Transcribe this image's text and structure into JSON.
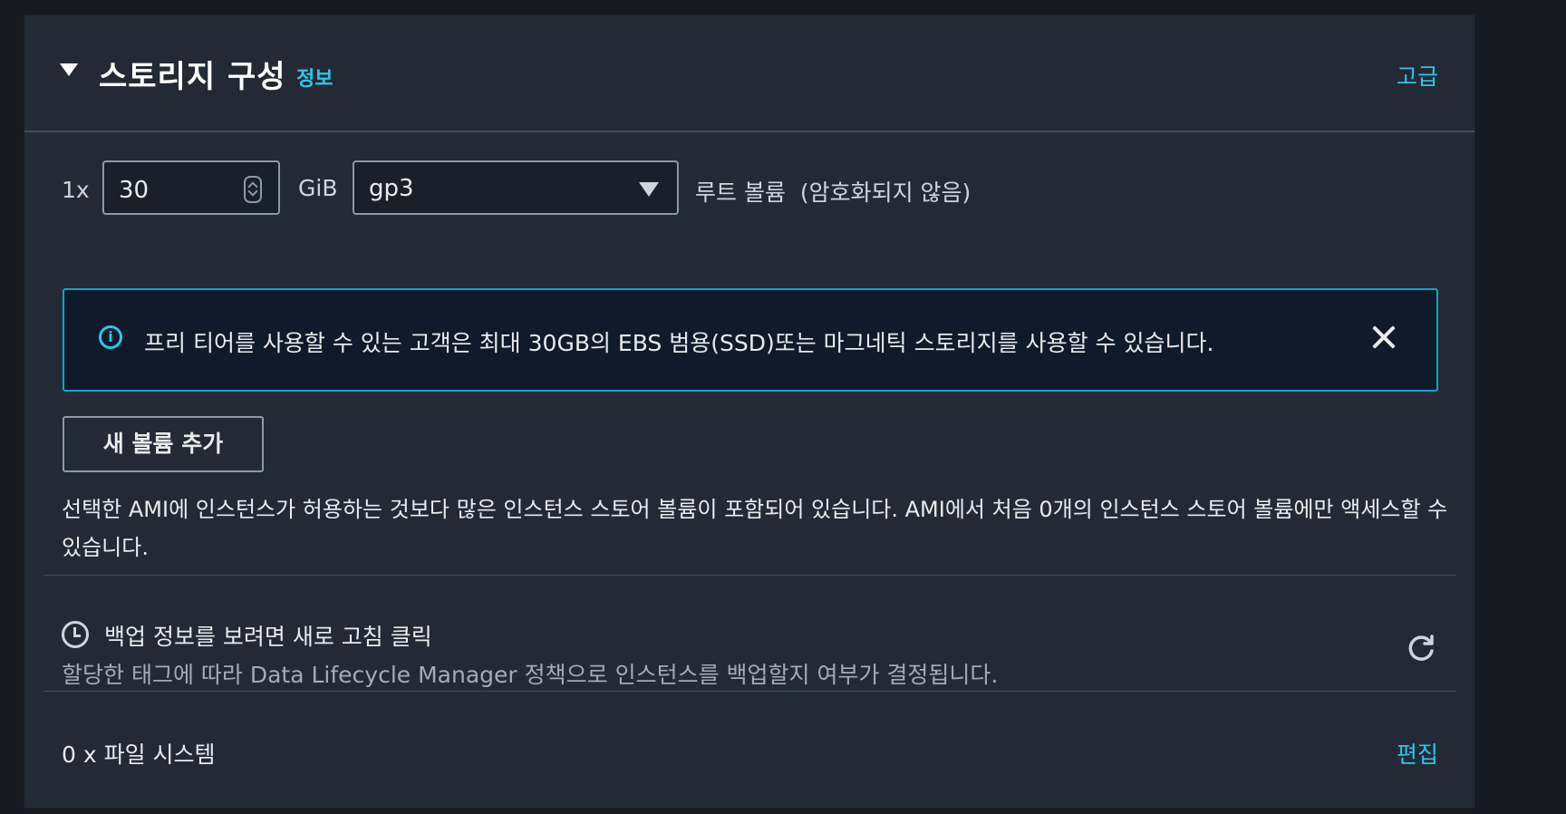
{
  "section": {
    "title": "스토리지 구성",
    "info_link": "정보",
    "advanced_link": "고급"
  },
  "volume": {
    "multiplier": "1x",
    "size_value": "30",
    "size_unit": "GiB",
    "type_value": "gp3",
    "description": "루트 볼륨  (암호화되지 않음)"
  },
  "alert": {
    "message": "프리 티어를 사용할 수 있는 고객은 최대 30GB의 EBS 범용(SSD)또는 마그네틱 스토리지를 사용할 수 있습니다.",
    "icon": "info-icon"
  },
  "add_volume_button": "새 볼륨 추가",
  "instance_store_note": "선택한 AMI에 인스턴스가 허용하는 것보다 많은 인스턴스 스토어 볼륨이 포함되어 있습니다. AMI에서 처음 0개의 인스턴스 스토어 볼륨에만 액세스할 수 있습니다.",
  "backup": {
    "title": "백업 정보를 보려면 새로 고침 클릭",
    "description": "할당한 태그에 따라 Data Lifecycle Manager 정책으로 인스턴스를 백업할지 여부가 결정됩니다."
  },
  "file_systems": {
    "label": "0 x 파일 시스템",
    "edit_link": "편집"
  },
  "colors": {
    "background": "#16191f",
    "panel": "#232a35",
    "link": "#2ec6e6",
    "alert_border": "#0ea5c9",
    "alert_bg": "#0f1b2a"
  }
}
